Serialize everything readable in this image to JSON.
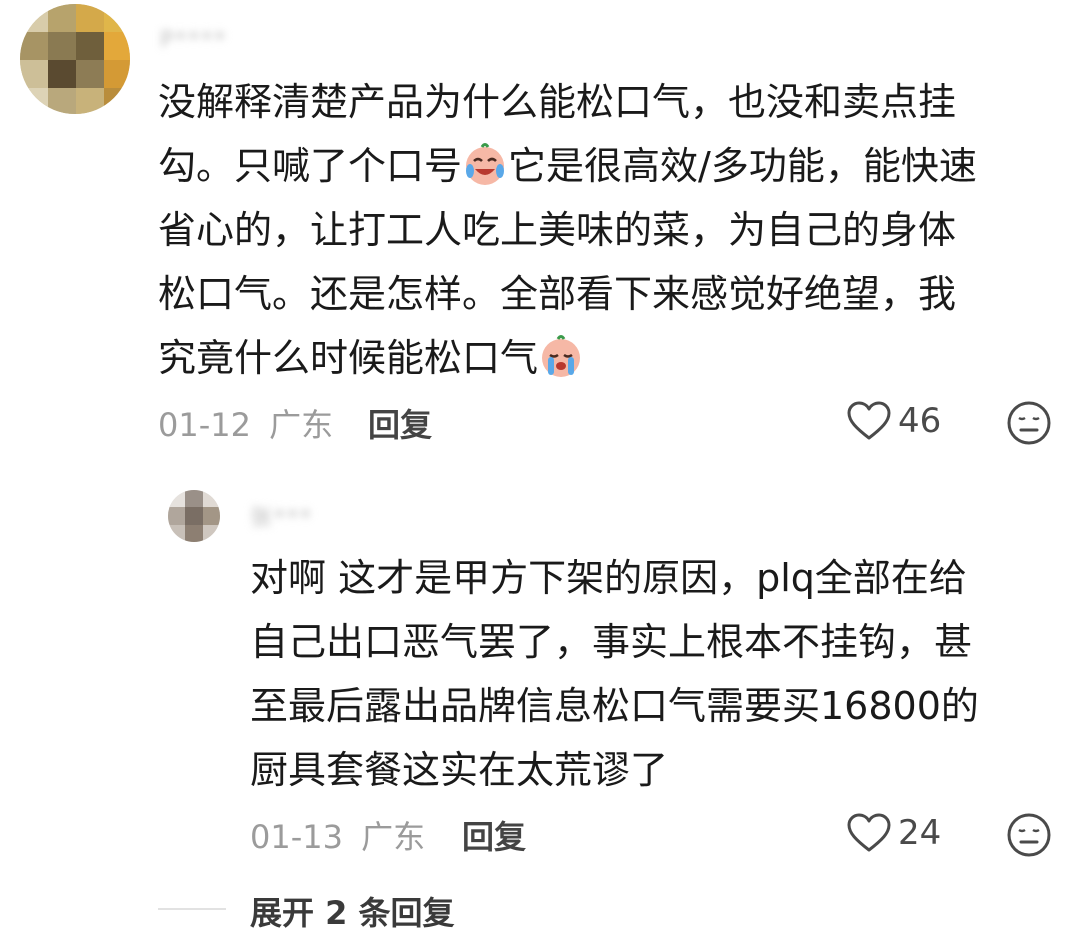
{
  "comment": {
    "username": "P****",
    "lines": [
      "没解释清楚产品为什么能松口气，也没和卖点挂",
      "勾。只喊了个口号",
      "它是很高效/多功能，能快速",
      "省心的，让打工人吃上美味的菜，为自己的身体",
      "松口气。还是怎样。全部看下来感觉好绝望，我",
      "究竟什么时候能松口气"
    ],
    "date": "01-12",
    "location": "广东",
    "reply_label": "回复",
    "likes": "46",
    "like_icon": "heart-outline-icon",
    "dislike_icon": "neutral-face-icon",
    "emojis": [
      "crying-laughing-face-emoji",
      "crying-face-emoji"
    ]
  },
  "reply": {
    "username": "张***",
    "lines": [
      "对啊  这才是甲方下架的原因，plq全部在给",
      "自己出口恶气罢了，事实上根本不挂钩，甚",
      "至最后露出品牌信息松口气需要买16800的",
      "厨具套餐这实在太荒谬了"
    ],
    "date": "01-13",
    "location": "广东",
    "reply_label": "回复",
    "likes": "24"
  },
  "expand": {
    "label": "展开 2 条回复"
  },
  "colors": {
    "text_primary": "#1a1a1a",
    "text_meta": "#9b9b9b",
    "divider": "#e2e2e2"
  }
}
